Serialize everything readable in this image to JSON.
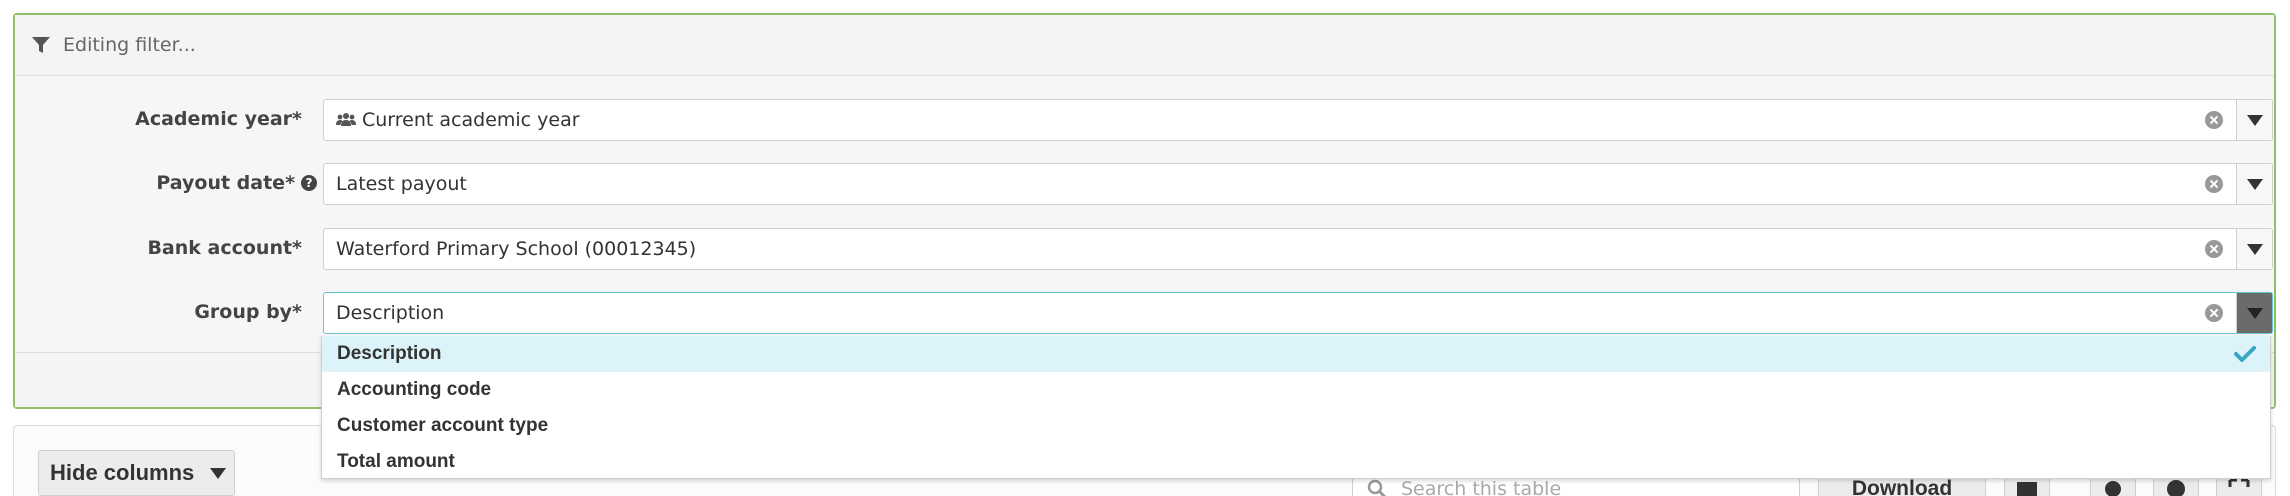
{
  "filter": {
    "header_title": "Editing filter...",
    "fields": [
      {
        "label": "Academic year*",
        "value": "Current academic year",
        "has_group_icon": true
      },
      {
        "label": "Payout date*",
        "value": "Latest payout",
        "has_help": true
      },
      {
        "label": "Bank account*",
        "value": "Waterford Primary School (00012345)"
      },
      {
        "label": "Group by*",
        "value": "Description",
        "open": true
      }
    ]
  },
  "group_by_options": [
    {
      "label": "Description",
      "selected": true
    },
    {
      "label": "Accounting code"
    },
    {
      "label": "Customer account type"
    },
    {
      "label": "Total amount"
    }
  ],
  "toolbar": {
    "hide_columns_label": "Hide columns",
    "search_placeholder": "Search this table",
    "download_label": "Download"
  },
  "colors": {
    "panel_border": "#8cc167",
    "open_border": "#6cc2cf",
    "selected_option_bg": "#dcf4f9",
    "check_color": "#3aa6c7"
  }
}
